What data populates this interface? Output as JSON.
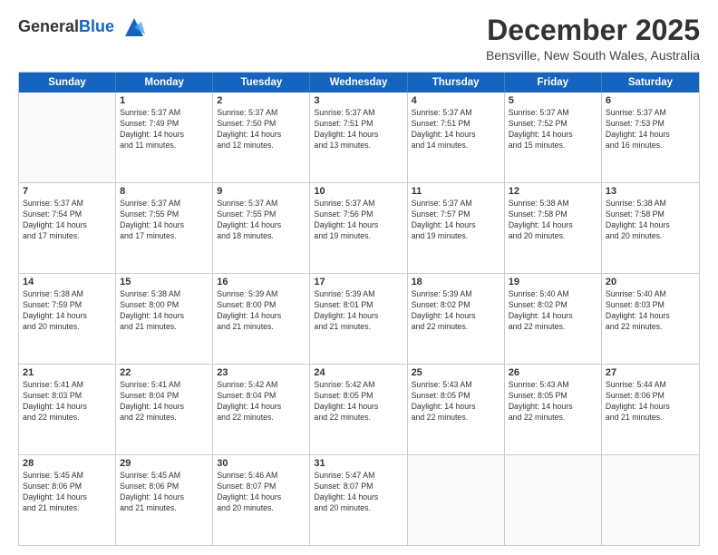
{
  "header": {
    "logo_general": "General",
    "logo_blue": "Blue",
    "month": "December 2025",
    "location": "Bensville, New South Wales, Australia"
  },
  "weekdays": [
    "Sunday",
    "Monday",
    "Tuesday",
    "Wednesday",
    "Thursday",
    "Friday",
    "Saturday"
  ],
  "rows": [
    [
      {
        "day": "",
        "info": ""
      },
      {
        "day": "1",
        "info": "Sunrise: 5:37 AM\nSunset: 7:49 PM\nDaylight: 14 hours\nand 11 minutes."
      },
      {
        "day": "2",
        "info": "Sunrise: 5:37 AM\nSunset: 7:50 PM\nDaylight: 14 hours\nand 12 minutes."
      },
      {
        "day": "3",
        "info": "Sunrise: 5:37 AM\nSunset: 7:51 PM\nDaylight: 14 hours\nand 13 minutes."
      },
      {
        "day": "4",
        "info": "Sunrise: 5:37 AM\nSunset: 7:51 PM\nDaylight: 14 hours\nand 14 minutes."
      },
      {
        "day": "5",
        "info": "Sunrise: 5:37 AM\nSunset: 7:52 PM\nDaylight: 14 hours\nand 15 minutes."
      },
      {
        "day": "6",
        "info": "Sunrise: 5:37 AM\nSunset: 7:53 PM\nDaylight: 14 hours\nand 16 minutes."
      }
    ],
    [
      {
        "day": "7",
        "info": "Sunrise: 5:37 AM\nSunset: 7:54 PM\nDaylight: 14 hours\nand 17 minutes."
      },
      {
        "day": "8",
        "info": "Sunrise: 5:37 AM\nSunset: 7:55 PM\nDaylight: 14 hours\nand 17 minutes."
      },
      {
        "day": "9",
        "info": "Sunrise: 5:37 AM\nSunset: 7:55 PM\nDaylight: 14 hours\nand 18 minutes."
      },
      {
        "day": "10",
        "info": "Sunrise: 5:37 AM\nSunset: 7:56 PM\nDaylight: 14 hours\nand 19 minutes."
      },
      {
        "day": "11",
        "info": "Sunrise: 5:37 AM\nSunset: 7:57 PM\nDaylight: 14 hours\nand 19 minutes."
      },
      {
        "day": "12",
        "info": "Sunrise: 5:38 AM\nSunset: 7:58 PM\nDaylight: 14 hours\nand 20 minutes."
      },
      {
        "day": "13",
        "info": "Sunrise: 5:38 AM\nSunset: 7:58 PM\nDaylight: 14 hours\nand 20 minutes."
      }
    ],
    [
      {
        "day": "14",
        "info": "Sunrise: 5:38 AM\nSunset: 7:59 PM\nDaylight: 14 hours\nand 20 minutes."
      },
      {
        "day": "15",
        "info": "Sunrise: 5:38 AM\nSunset: 8:00 PM\nDaylight: 14 hours\nand 21 minutes."
      },
      {
        "day": "16",
        "info": "Sunrise: 5:39 AM\nSunset: 8:00 PM\nDaylight: 14 hours\nand 21 minutes."
      },
      {
        "day": "17",
        "info": "Sunrise: 5:39 AM\nSunset: 8:01 PM\nDaylight: 14 hours\nand 21 minutes."
      },
      {
        "day": "18",
        "info": "Sunrise: 5:39 AM\nSunset: 8:02 PM\nDaylight: 14 hours\nand 22 minutes."
      },
      {
        "day": "19",
        "info": "Sunrise: 5:40 AM\nSunset: 8:02 PM\nDaylight: 14 hours\nand 22 minutes."
      },
      {
        "day": "20",
        "info": "Sunrise: 5:40 AM\nSunset: 8:03 PM\nDaylight: 14 hours\nand 22 minutes."
      }
    ],
    [
      {
        "day": "21",
        "info": "Sunrise: 5:41 AM\nSunset: 8:03 PM\nDaylight: 14 hours\nand 22 minutes."
      },
      {
        "day": "22",
        "info": "Sunrise: 5:41 AM\nSunset: 8:04 PM\nDaylight: 14 hours\nand 22 minutes."
      },
      {
        "day": "23",
        "info": "Sunrise: 5:42 AM\nSunset: 8:04 PM\nDaylight: 14 hours\nand 22 minutes."
      },
      {
        "day": "24",
        "info": "Sunrise: 5:42 AM\nSunset: 8:05 PM\nDaylight: 14 hours\nand 22 minutes."
      },
      {
        "day": "25",
        "info": "Sunrise: 5:43 AM\nSunset: 8:05 PM\nDaylight: 14 hours\nand 22 minutes."
      },
      {
        "day": "26",
        "info": "Sunrise: 5:43 AM\nSunset: 8:05 PM\nDaylight: 14 hours\nand 22 minutes."
      },
      {
        "day": "27",
        "info": "Sunrise: 5:44 AM\nSunset: 8:06 PM\nDaylight: 14 hours\nand 21 minutes."
      }
    ],
    [
      {
        "day": "28",
        "info": "Sunrise: 5:45 AM\nSunset: 8:06 PM\nDaylight: 14 hours\nand 21 minutes."
      },
      {
        "day": "29",
        "info": "Sunrise: 5:45 AM\nSunset: 8:06 PM\nDaylight: 14 hours\nand 21 minutes."
      },
      {
        "day": "30",
        "info": "Sunrise: 5:46 AM\nSunset: 8:07 PM\nDaylight: 14 hours\nand 20 minutes."
      },
      {
        "day": "31",
        "info": "Sunrise: 5:47 AM\nSunset: 8:07 PM\nDaylight: 14 hours\nand 20 minutes."
      },
      {
        "day": "",
        "info": ""
      },
      {
        "day": "",
        "info": ""
      },
      {
        "day": "",
        "info": ""
      }
    ]
  ]
}
